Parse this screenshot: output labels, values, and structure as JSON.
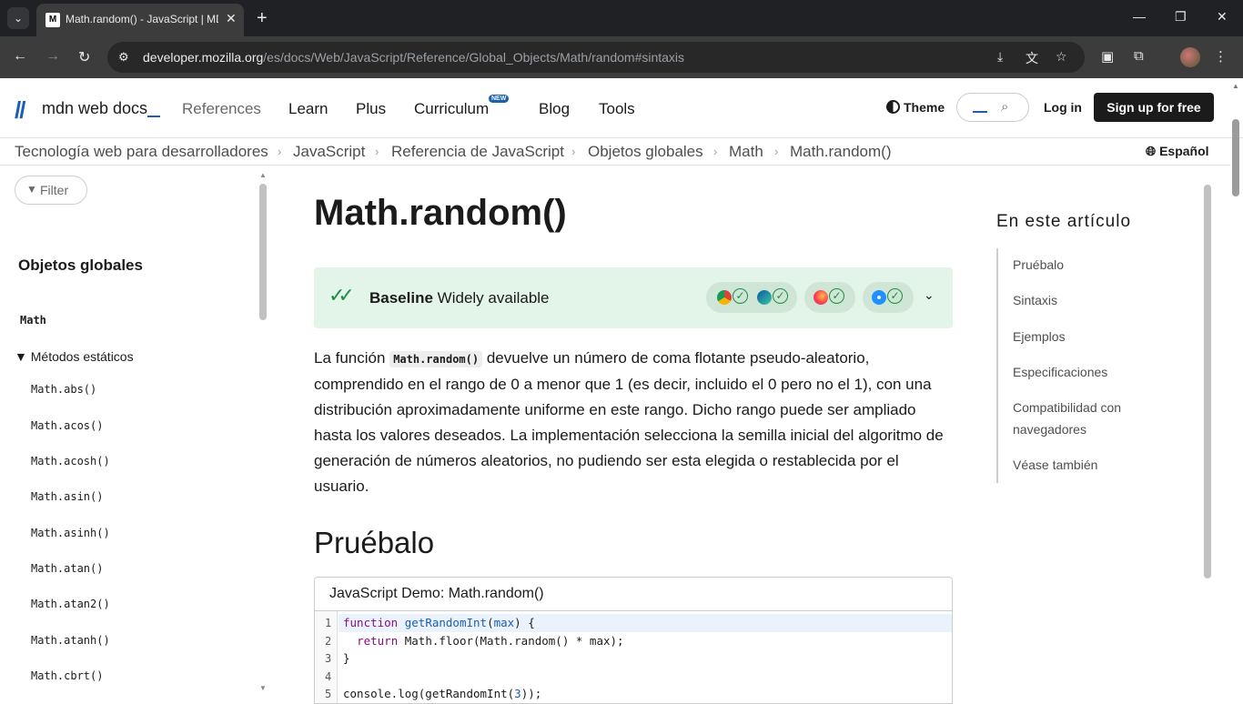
{
  "browser": {
    "tab_title": "Math.random() - JavaScript | MDN",
    "tab_favicon": "M",
    "url_host": "developer.mozilla.org",
    "url_path": "/es/docs/Web/JavaScript/Reference/Global_Objects/Math/random#sintaxis"
  },
  "header": {
    "logo_text": "mdn web docs",
    "nav": [
      "References",
      "Learn",
      "Plus",
      "Curriculum",
      "Blog",
      "Tools"
    ],
    "new_badge": "NEW",
    "theme_label": "Theme",
    "login_label": "Log in",
    "signup_label": "Sign up for free"
  },
  "breadcrumb": {
    "items": [
      "Tecnología web para desarrolladores",
      "JavaScript",
      "Referencia de JavaScript",
      "Objetos globales",
      "Math",
      "Math.random()"
    ],
    "language": "Español"
  },
  "sidebar": {
    "filter_placeholder": "Filter",
    "title": "Objetos globales",
    "current": "Math",
    "group": "Métodos estáticos",
    "links": [
      "Math.abs()",
      "Math.acos()",
      "Math.acosh()",
      "Math.asin()",
      "Math.asinh()",
      "Math.atan()",
      "Math.atan2()",
      "Math.atanh()",
      "Math.cbrt()"
    ]
  },
  "main": {
    "title": "Math.random()",
    "baseline_bold": "Baseline",
    "baseline_rest": "Widely available",
    "para_before": "La función ",
    "para_code": "Math.random()",
    "para_after": " devuelve un número de coma flotante pseudo-aleatorio, comprendido en el rango de 0 a menor que 1 (es decir, incluido el 0 pero no el 1), con una distribución aproximadamente uniforme en este rango. Dicho rango puede ser ampliado hasta los valores deseados. La implementación selecciona la semilla inicial del algoritmo de generación de números aleatorios, no pudiendo ser esta elegida o restablecida por el usuario.",
    "section_title": "Pruébalo",
    "demo_title": "JavaScript Demo: Math.random()",
    "line_numbers": [
      "1",
      "2",
      "3",
      "4",
      "5"
    ]
  },
  "toc": {
    "title": "En este artículo",
    "items": [
      "Pruébalo",
      "Sintaxis",
      "Ejemplos",
      "Especificaciones",
      "Compatibilidad con navegadores",
      "Véase también"
    ]
  },
  "colors": {
    "accent": "#1a5fb4",
    "baseline_bg": "#e3f5e8",
    "baseline_check": "#1e8e3e"
  }
}
